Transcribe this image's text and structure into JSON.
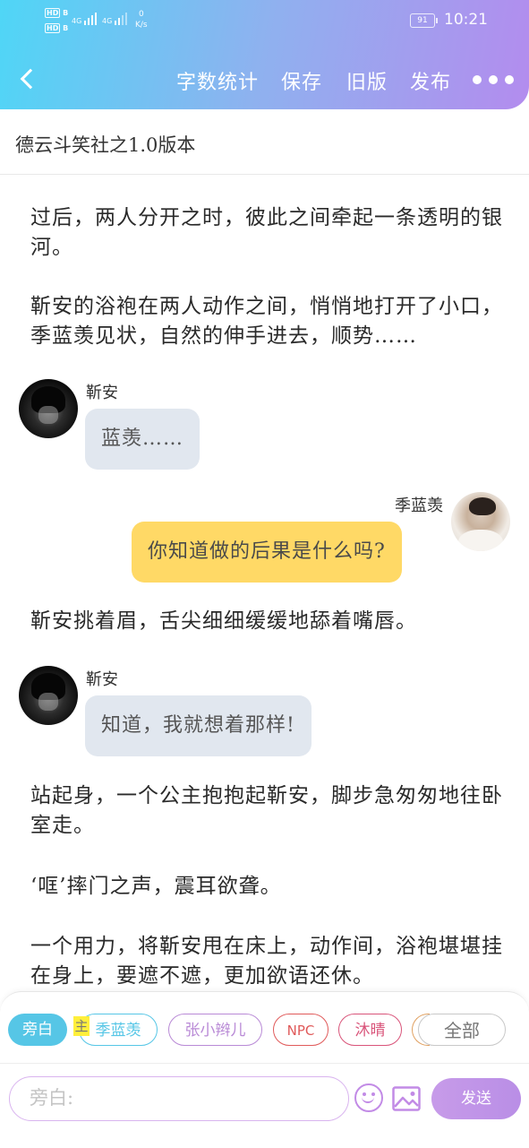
{
  "status_bar": {
    "sim1": "HD",
    "sim1_sub": "B",
    "sim2": "HD",
    "sim2_sub": "B",
    "net1": "4G",
    "net2": "4G",
    "speed_value": "0",
    "speed_unit": "K/s",
    "battery": "91",
    "time": "10:21"
  },
  "nav": {
    "back_icon": "chevron-left-icon",
    "word_count": "字数统计",
    "save": "保存",
    "old_version": "旧版",
    "publish": "发布",
    "more_icon": "more-dots-icon"
  },
  "document": {
    "title": "德云斗笑社之1.0版本"
  },
  "content": {
    "p1": "过后，两人分开之时，彼此之间牵起一条透明的银河。",
    "p2": "靳安的浴袍在两人动作之间，悄悄地打开了小口，季蓝羡见状，自然的伸手进去，顺势……",
    "msg1": {
      "speaker": "靳安",
      "text": "蓝羡……"
    },
    "msg2": {
      "speaker": "季蓝羡",
      "text": "你知道做的后果是什么吗?"
    },
    "p3": "靳安挑着眉，舌尖细细缓缓地舔着嘴唇。",
    "msg3": {
      "speaker": "靳安",
      "text": "知道，我就想着那样!"
    },
    "p4": "站起身，一个公主抱抱起靳安，脚步急匆匆地往卧室走。",
    "p5": "‘哐’摔门之声，震耳欲聋。",
    "p6": "一个用力，将靳安甩在床上，动作间，浴袍堪堪挂在身上，要遮不遮，更加欲语还休。"
  },
  "roles": {
    "narrator": "旁白",
    "main_badge": "主",
    "ji": "季蓝羡",
    "zhang": "张小辫儿",
    "npc": "NPC",
    "muqing": "沐晴",
    "all": "全部"
  },
  "colors": {
    "narrator_chip": "#56c6e6",
    "ji_chip": "#56c6e6",
    "zhang_chip": "#b98ad6",
    "npc_chip": "#e05a5a",
    "muqing_chip": "#d9547a",
    "all_chip": "#bbbbbb",
    "right_bubble": "#ffd966",
    "left_bubble": "#e1e7ef",
    "send": "#c08fe8"
  },
  "input": {
    "placeholder": "旁白:",
    "send": "发送",
    "emoji_icon": "emoji-smile-icon",
    "image_icon": "image-icon"
  }
}
